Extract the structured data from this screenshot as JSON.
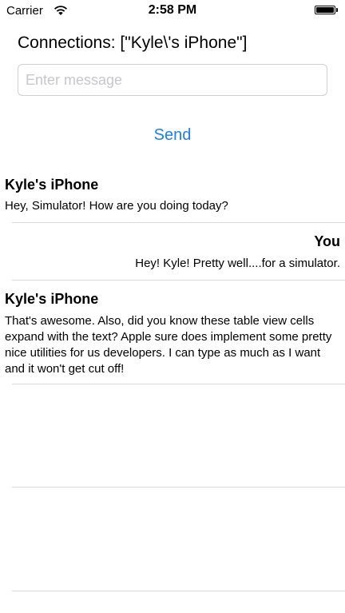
{
  "status_bar": {
    "carrier": "Carrier",
    "time": "2:58 PM",
    "wifi_icon": "wifi-icon",
    "battery_icon": "battery-icon",
    "battery_level": 1.0
  },
  "header": {
    "connections": "Connections: [\"Kyle\\'s iPhone\"]"
  },
  "compose": {
    "placeholder": "Enter message",
    "value": "",
    "send_label": "Send",
    "accent_color": "#1a7ef5"
  },
  "messages": [
    {
      "sender": "Kyle's iPhone",
      "text": "Hey, Simulator! How are you doing today?",
      "align": "left"
    },
    {
      "sender": "You",
      "text": "Hey! Kyle! Pretty well....for a simulator.",
      "align": "right"
    },
    {
      "sender": "Kyle's iPhone",
      "text": "That's awesome. Also, did you know these table view cells expand with the text? Apple sure does implement some pretty nice utilities for us developers. I can type as much as I want and it won't get cut off!",
      "align": "left"
    }
  ]
}
